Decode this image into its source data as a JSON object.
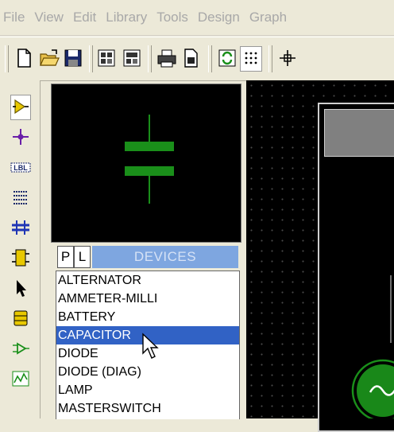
{
  "menu": [
    "File",
    "View",
    "Edit",
    "Library",
    "Tools",
    "Design",
    "Graph"
  ],
  "toolbar": {
    "icons": [
      "new-file-icon",
      "open-folder-icon",
      "save-icon",
      "import-icon",
      "export-icon",
      "print-icon",
      "page-setup-icon",
      "refresh-icon",
      "grid-icon",
      "origin-icon"
    ]
  },
  "left_toolbar": {
    "icons": [
      "component-mode-icon",
      "junction-icon",
      "wire-label-icon",
      "script-icon",
      "bus-icon",
      "subcircuit-icon",
      "selection-arrow-icon",
      "terminal-icon",
      "port-icon",
      "graph-icon"
    ],
    "label_tool_text": "LBL"
  },
  "devices_panel": {
    "p_label": "P",
    "l_label": "L",
    "title": "DEVICES",
    "items": [
      "ALTERNATOR",
      "AMMETER-MILLI",
      "BATTERY",
      "CAPACITOR",
      "DIODE",
      "DIODE (DIAG)",
      "LAMP",
      "MASTERSWITCH"
    ],
    "selected": "CAPACITOR"
  },
  "colors": {
    "component_green": "#1a8f1a",
    "selection_blue": "#3162c5",
    "devices_header": "#7ea6e0"
  }
}
